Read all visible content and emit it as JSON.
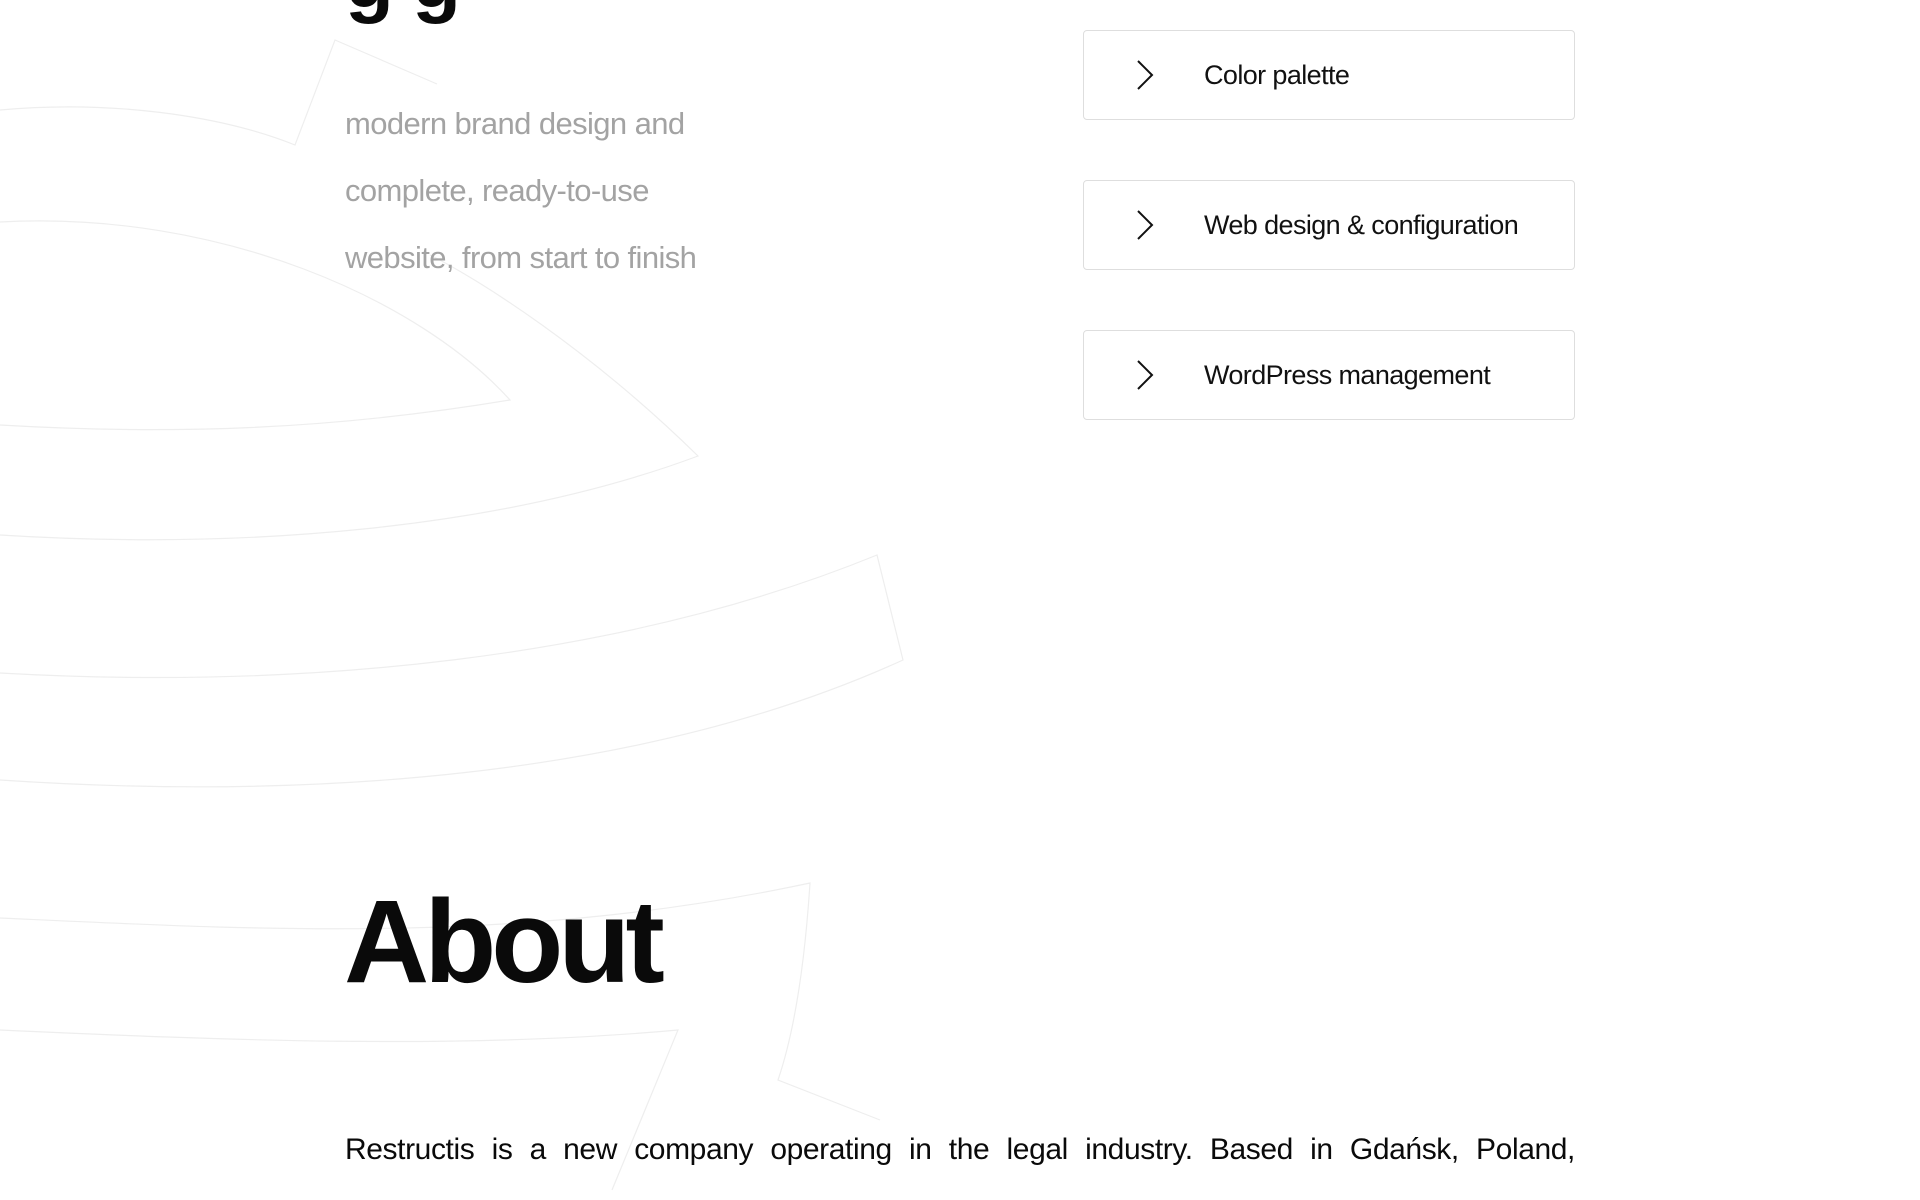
{
  "intro": {
    "lines": [
      "modern brand design and",
      "complete, ready-to-use",
      "website, from start to finish"
    ]
  },
  "services": [
    {
      "icon": "chevron-right-icon",
      "label": "Color palette"
    },
    {
      "icon": "chevron-right-icon",
      "label": "Web design & configuration"
    },
    {
      "icon": "chevron-right-icon",
      "label": "WordPress management"
    }
  ],
  "about": {
    "title": "About",
    "text": "Restructis is a new company operating in the legal industry. Based in Gdańsk, Poland,"
  },
  "colors": {
    "text_primary": "#0a0a0a",
    "text_muted": "#a3a3a3",
    "card_border": "#dedede",
    "background_art": "#eeeeee"
  }
}
